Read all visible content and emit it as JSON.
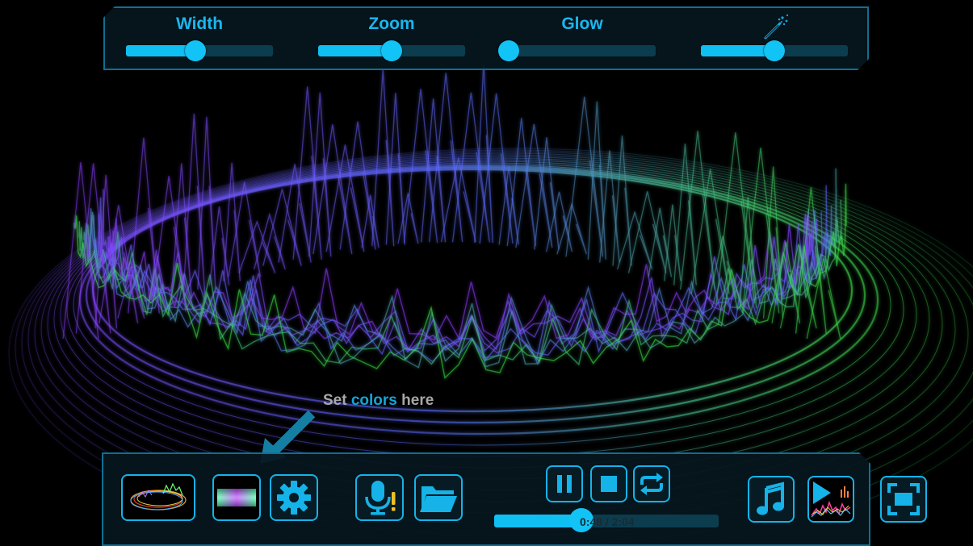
{
  "colors": {
    "accent": "#12c3f5",
    "track": "#0b3d4f",
    "panel_border": "#0f6f93",
    "hint_gray": "#a7a7a7",
    "hint_accent": "#13a6d8"
  },
  "sliders": [
    {
      "label": "Width",
      "value": 0.47
    },
    {
      "label": "Zoom",
      "value": 0.5
    },
    {
      "label": "Glow",
      "value": 0.0
    },
    {
      "label": "",
      "icon": "magic-wand-icon",
      "value": 0.5
    }
  ],
  "hint": {
    "prefix": "Set",
    "accent": "colors",
    "suffix": "here"
  },
  "toolbar": {
    "visualizer_thumb_icon": "visualizer-preview-icon",
    "color_icon": "color-gradient-icon",
    "settings_icon": "gear-icon",
    "mic_icon": "microphone-warning-icon",
    "folder_icon": "open-folder-icon",
    "pause_icon": "pause-icon",
    "stop_icon": "stop-icon",
    "repeat_icon": "repeat-icon",
    "music_icon": "music-note-icon",
    "playlist_icon": "play-spectrum-icon",
    "fullscreen_icon": "fullscreen-icon"
  },
  "playback": {
    "time": "0:48 / 2:04",
    "progress": 0.387
  }
}
